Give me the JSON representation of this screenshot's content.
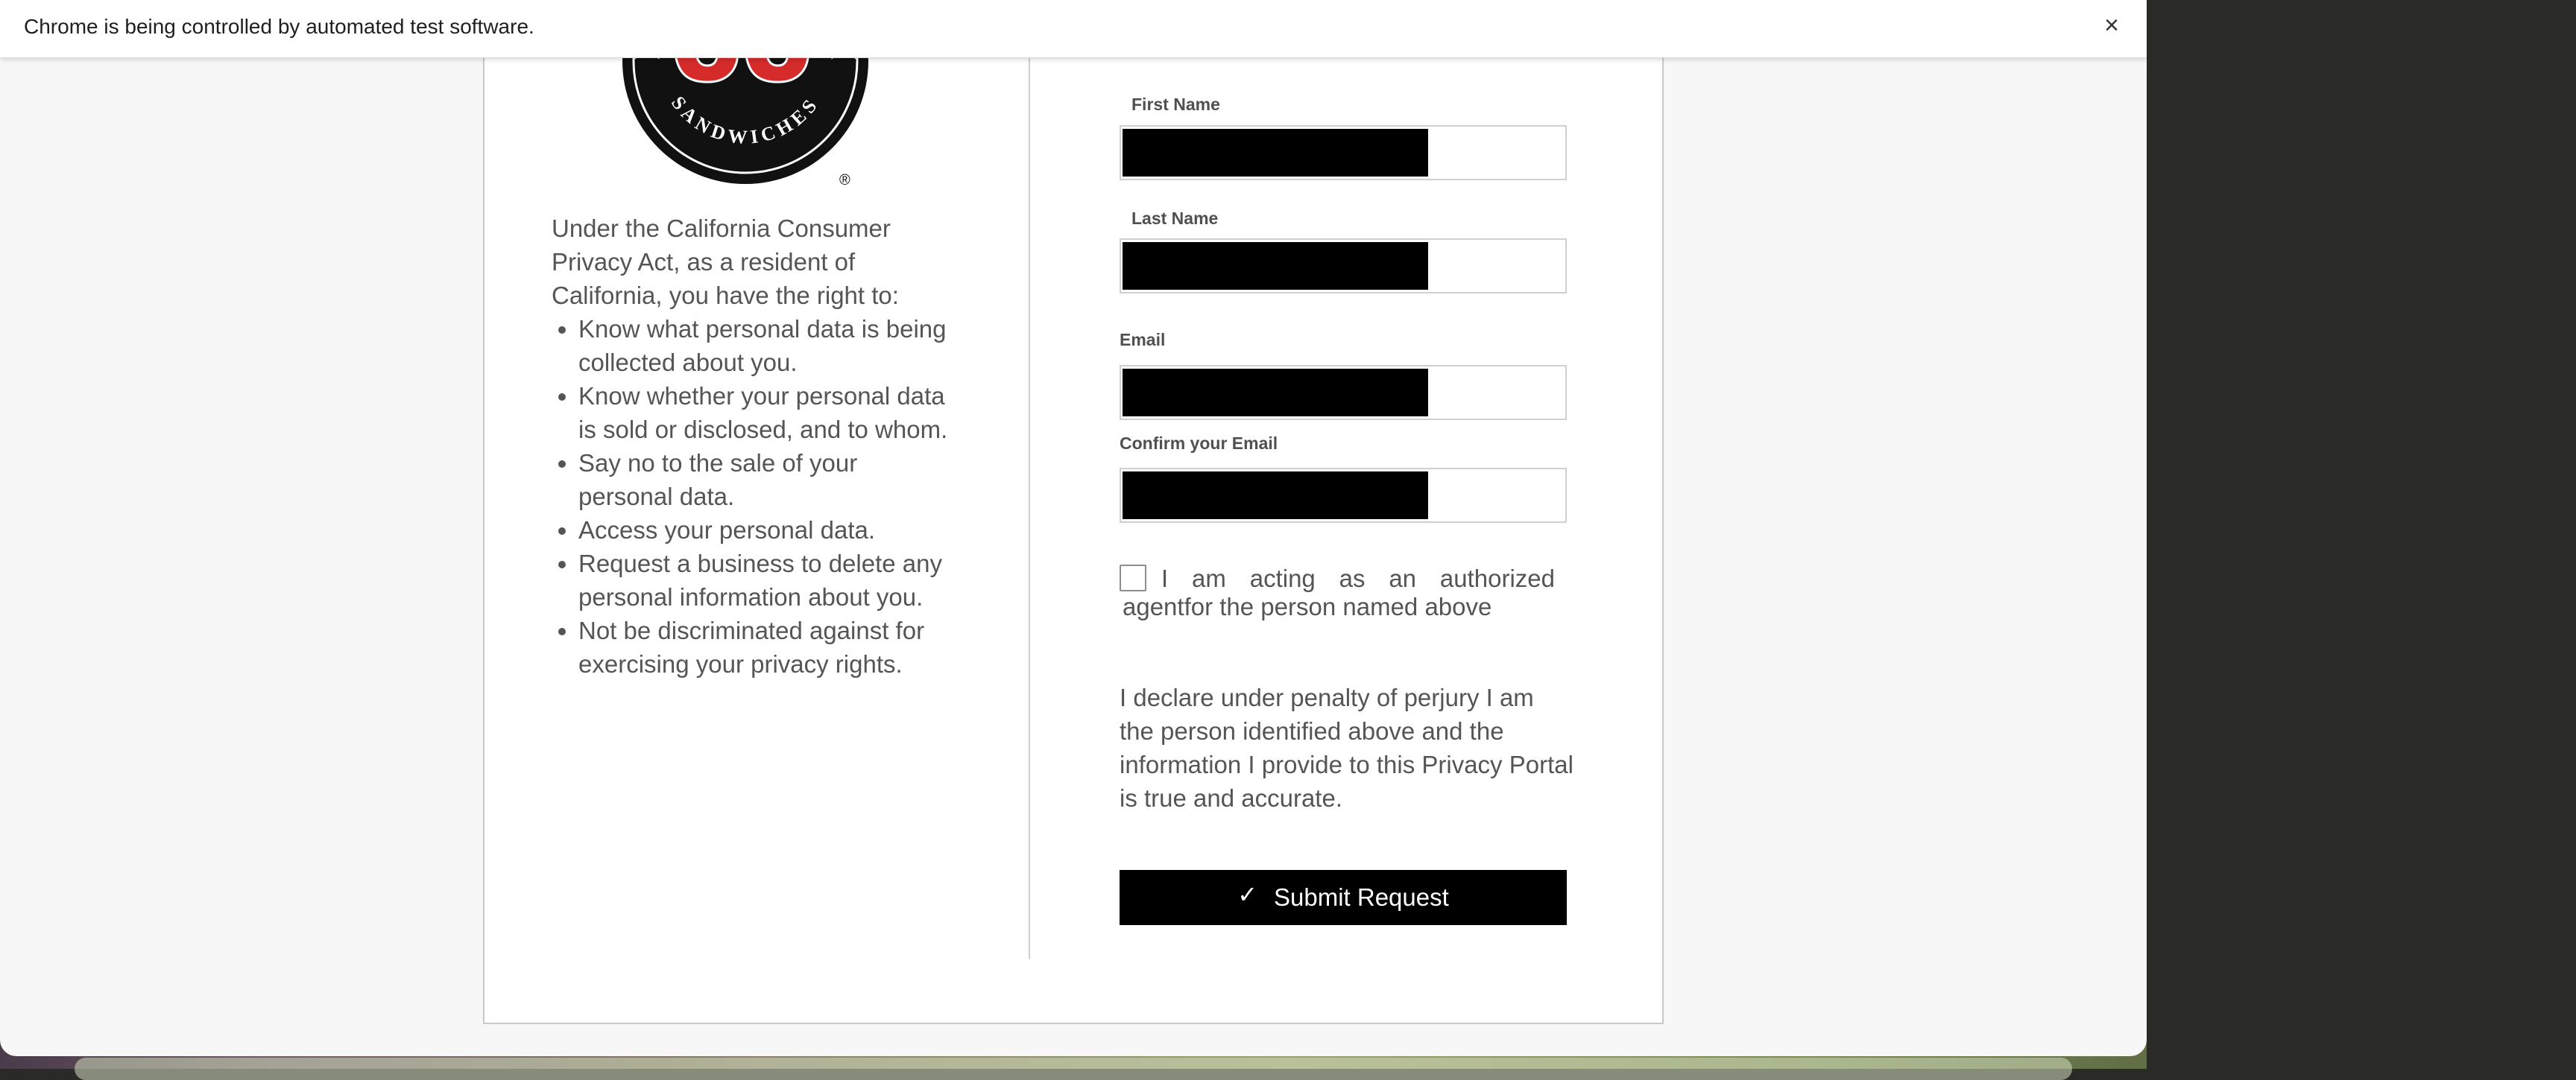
{
  "automation_bar": {
    "message": "Chrome is being controlled by automated test software.",
    "close_glyph": "×"
  },
  "logo": {
    "brand_letters": "JJ",
    "tagline": "SANDWICHES",
    "registered_mark": "®",
    "colors": {
      "ring": "#111111",
      "letters": "#d52b2b",
      "stars": "#d52b2b"
    }
  },
  "rights": {
    "intro": "Under the California Consumer Privacy Act, as a resident of California, you have the right to:",
    "items": [
      "Know what personal data is being collected about you.",
      "Know whether your personal data is sold or disclosed, and to whom.",
      "Say no to the sale of your personal data.",
      "Access your personal data.",
      "Request a business to delete any personal information about you.",
      "Not be discriminated against for exercising your privacy rights."
    ]
  },
  "form": {
    "first_name_label": "First Name",
    "last_name_label": "Last Name",
    "email_label": "Email",
    "confirm_email_label": "Confirm your Email",
    "agent_checkbox_label": "I am acting as an authorized agentfor the person named above",
    "declaration": "I declare under penalty of perjury I am the person identified above and the information I provide to this Privacy Portal is true and accurate.",
    "submit_label": "Submit Request",
    "submit_icon": "✓"
  }
}
